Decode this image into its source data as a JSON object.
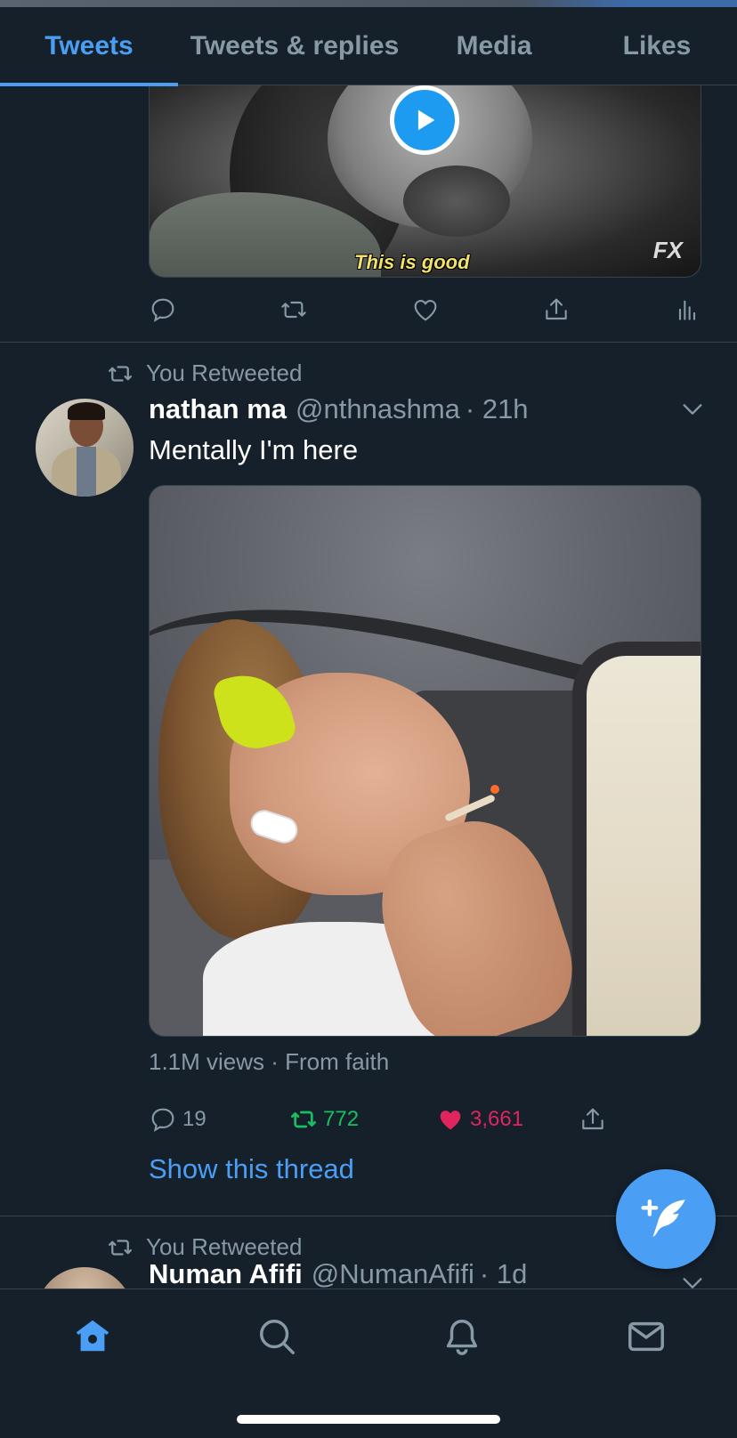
{
  "tabs": [
    {
      "label": "Tweets",
      "active": true
    },
    {
      "label": "Tweets & replies",
      "active": false
    },
    {
      "label": "Media",
      "active": false
    },
    {
      "label": "Likes",
      "active": false
    }
  ],
  "video_top": {
    "caption": "This is good",
    "watermark": "FX"
  },
  "tweet": {
    "retweet_label": "You Retweeted",
    "name": "nathan ma",
    "handle": "@nthnashma",
    "time": "· 21h",
    "text": "Mentally I'm here",
    "views": "1.1M views · From faith",
    "replies": "19",
    "retweets": "772",
    "likes": "3,661",
    "show_thread": "Show this thread"
  },
  "next_tweet": {
    "retweet_label": "You Retweeted",
    "name": "Numan Afifi",
    "handle": "@NumanAfifi",
    "time": "· 1d"
  },
  "colors": {
    "accent": "#4a9ff5",
    "retweet_green": "#17bf63",
    "like_pink": "#e0245e",
    "muted": "#8899a6",
    "background": "#15202b"
  },
  "icons": {
    "reply": "reply-icon",
    "retweet": "retweet-icon",
    "like": "heart-icon",
    "share": "share-icon",
    "analytics": "analytics-icon",
    "compose": "compose-tweet-icon",
    "nav": [
      "home-icon",
      "search-icon",
      "notifications-icon",
      "messages-icon"
    ]
  }
}
